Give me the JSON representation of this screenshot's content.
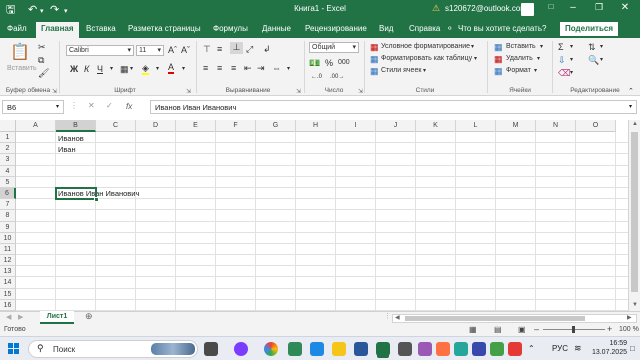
{
  "titlebar": {
    "title": "Книга1  -  Excel",
    "account": "s120672@outlook.com",
    "save_icon": "save-icon",
    "undo_icon": "undo-icon",
    "redo_icon": "redo-icon",
    "customize_icon": "chevron-down-icon"
  },
  "tabs": [
    "Файл",
    "Главная",
    "Вставка",
    "Разметка страницы",
    "Формулы",
    "Данные",
    "Рецензирование",
    "Вид",
    "Справка"
  ],
  "active_tab": "Главная",
  "tell_me": "Что вы хотите сделать?",
  "share": "Поделиться",
  "ribbon": {
    "clipboard": {
      "paste": "Вставить",
      "label": "Буфер обмена"
    },
    "font": {
      "name": "Calibri",
      "size": "11",
      "bold": "Ж",
      "italic": "К",
      "underline": "Ч",
      "label": "Шрифт"
    },
    "alignment": {
      "label": "Выравнивание"
    },
    "number": {
      "format": "Общий",
      "percent": "%",
      "thousands": "000",
      "label": "Число"
    },
    "styles": {
      "conditional": "Условное форматирование",
      "as_table": "Форматировать как таблицу",
      "cell_styles": "Стили ячеек",
      "label": "Стили"
    },
    "cells": {
      "insert": "Вставить",
      "delete": "Удалить",
      "format": "Формат",
      "label": "Ячейки"
    },
    "editing": {
      "label": "Редактирование"
    }
  },
  "formula_bar": {
    "name_box": "B6",
    "fx": "fx",
    "value": "Иванов Иван Иванович"
  },
  "columns": [
    "A",
    "B",
    "C",
    "D",
    "E",
    "F",
    "G",
    "H",
    "I",
    "J",
    "K",
    "L",
    "M",
    "N",
    "O"
  ],
  "rows": [
    "1",
    "2",
    "3",
    "4",
    "5",
    "6",
    "7",
    "8",
    "9",
    "10",
    "11",
    "12",
    "13",
    "14",
    "15",
    "16"
  ],
  "cells": {
    "B1": "Иванов",
    "B2": "Иван",
    "B6": "Иванов Иван Иванович"
  },
  "selected_cell": "B6",
  "sheet_tab": "Лист1",
  "status": {
    "ready": "Готово",
    "zoom": "100 %"
  },
  "taskbar": {
    "search": "Поиск",
    "lang": "РУС",
    "time": "16:59",
    "date": "13.07.2025"
  },
  "colors": {
    "excel_green": "#217346",
    "grid_line": "#e1e1e1"
  }
}
